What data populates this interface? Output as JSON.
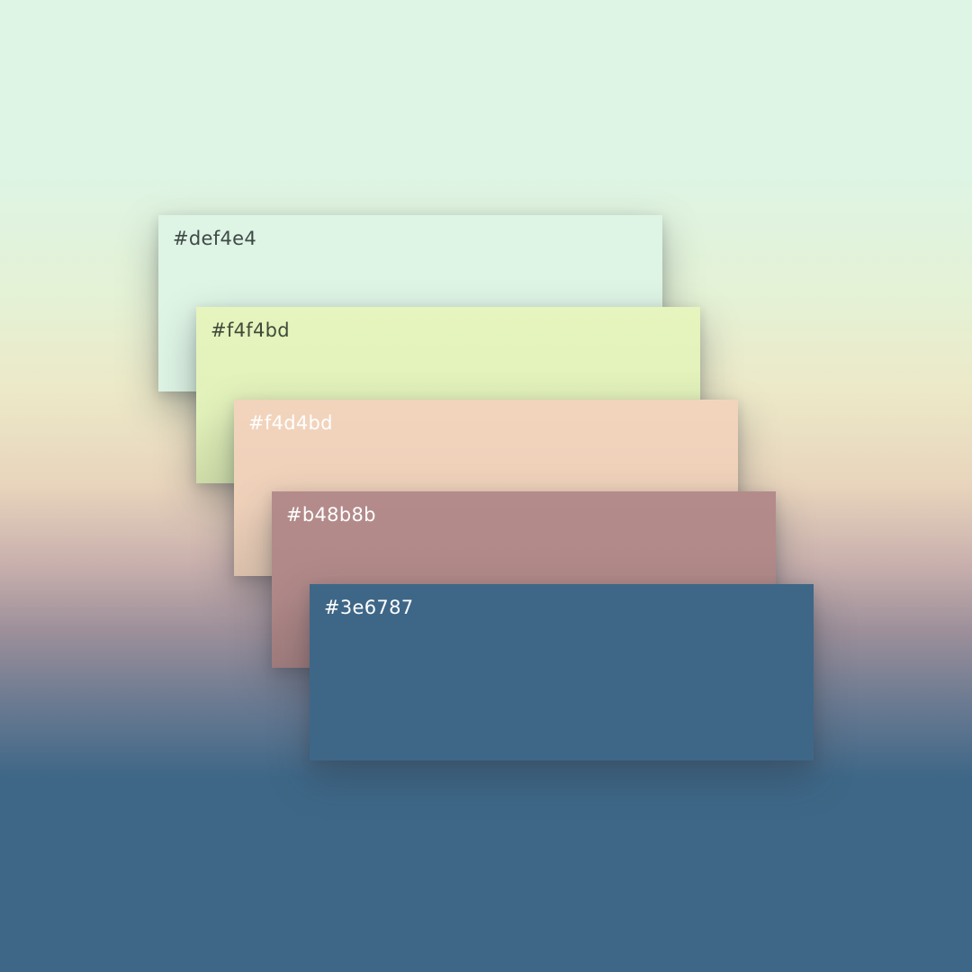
{
  "palette": {
    "swatches": [
      {
        "label": "#def4e4",
        "color": "#def4e4"
      },
      {
        "label": "#f4f4bd",
        "color": "#f4f4bd"
      },
      {
        "label": "#f4d4bd",
        "color": "#f4d4bd"
      },
      {
        "label": "#b48b8b",
        "color": "#b48b8b"
      },
      {
        "label": "#3e6787",
        "color": "#3e6787"
      }
    ]
  }
}
